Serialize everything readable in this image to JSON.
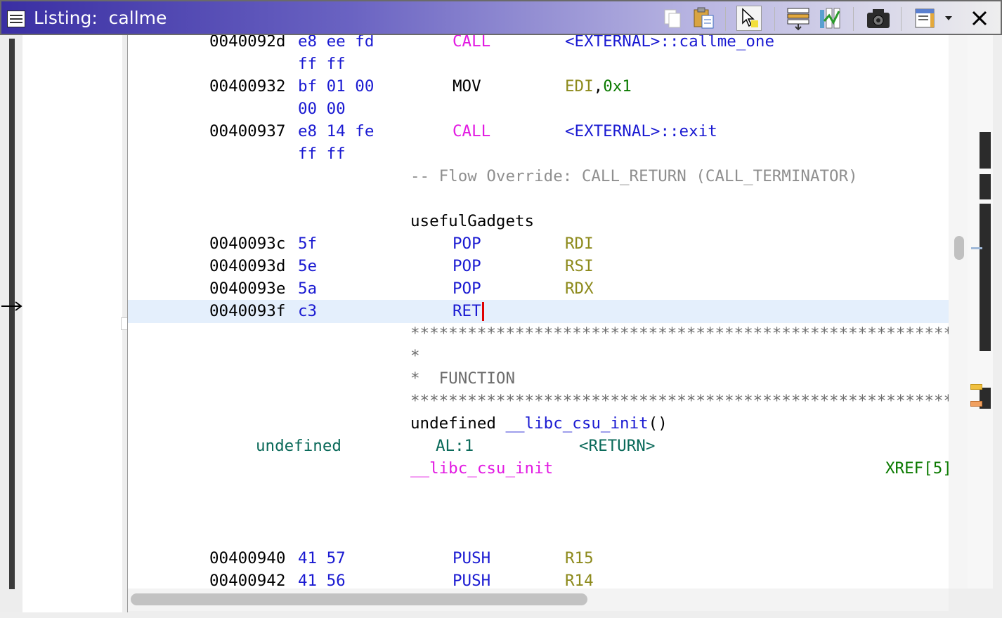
{
  "window": {
    "title": "Listing:  callme",
    "toolbar": {
      "buttons": [
        "copy-icon",
        "paste-icon",
        "select-cursor-icon",
        "field-edit-icon",
        "diff-icon",
        "snapshot-icon",
        "window-options-icon",
        "dropdown-arrow-icon",
        "close-icon"
      ]
    }
  },
  "listing": {
    "rows": [
      {
        "addr": "0040092d",
        "bytes": "e8 ee fd",
        "mnemonic": "CALL",
        "operand": "<EXTERNAL>::callme_one"
      },
      {
        "bytes": "ff ff"
      },
      {
        "addr": "00400932",
        "bytes": "bf 01 00",
        "mnemonic": "MOV",
        "op_reg": "EDI",
        "op_sep": ",",
        "op_imm": "0x1"
      },
      {
        "bytes": "00 00"
      },
      {
        "addr": "00400937",
        "bytes": "e8 14 fe",
        "mnemonic": "CALL",
        "operand": "<EXTERNAL>::exit"
      },
      {
        "bytes": "ff ff"
      },
      {
        "comment": "-- Flow Override: CALL_RETURN (CALL_TERMINATOR)"
      },
      {
        "label": "usefulGadgets"
      },
      {
        "addr": "0040093c",
        "bytes": "5f",
        "mnemonic": "POP",
        "op_reg": "RDI"
      },
      {
        "addr": "0040093d",
        "bytes": "5e",
        "mnemonic": "POP",
        "op_reg": "RSI"
      },
      {
        "addr": "0040093e",
        "bytes": "5a",
        "mnemonic": "POP",
        "op_reg": "RDX"
      },
      {
        "addr": "0040093f",
        "bytes": "c3",
        "mnemonic": "RET",
        "selected": true
      },
      {
        "stars": "**********************************************************"
      },
      {
        "star": "*"
      },
      {
        "star": "*  FUNCTION"
      },
      {
        "stars": "**********************************************************"
      },
      {
        "sig_ret": "undefined",
        "sig_name": "__libc_csu_init",
        "sig_args": "()"
      },
      {
        "ret_type": "undefined",
        "ret_storage": "AL:1",
        "ret_name": "<RETURN>"
      },
      {
        "func_label": "__libc_csu_init",
        "xref": "XREF[5]"
      },
      {
        "addr": "00400940",
        "bytes": "41 57",
        "mnemonic": "PUSH",
        "op_reg": "R15"
      },
      {
        "addr": "00400942",
        "bytes": "41 56",
        "mnemonic": "PUSH",
        "op_reg": "R14"
      }
    ]
  }
}
